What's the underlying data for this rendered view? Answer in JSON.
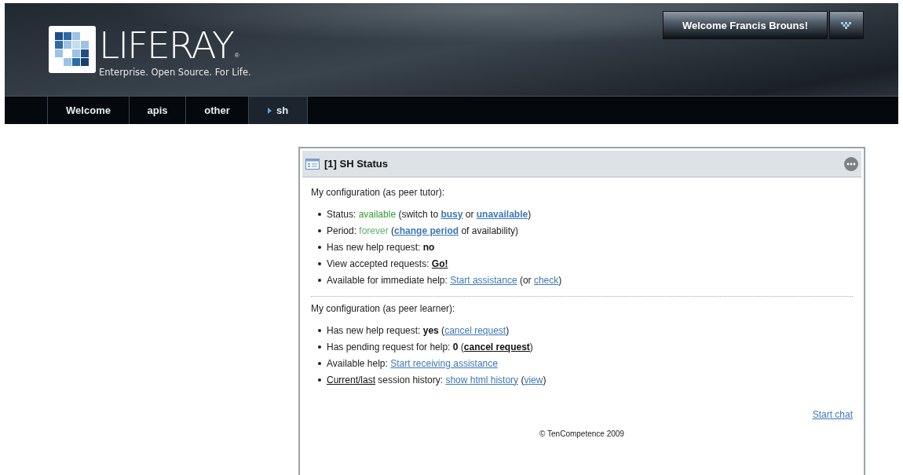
{
  "header": {
    "logo": {
      "wordmark": "LIFERAY",
      "registered": "®",
      "tagline": "Enterprise. Open Source. For Life."
    },
    "user_menu": {
      "label": "Welcome Francis Brouns!"
    },
    "nav": [
      {
        "label": "Welcome",
        "selected": false
      },
      {
        "label": "apis",
        "selected": false
      },
      {
        "label": "other",
        "selected": false
      },
      {
        "label": "sh",
        "selected": true
      }
    ]
  },
  "portlet": {
    "title": "[1] SH Status",
    "sections": [
      {
        "heading": "My configuration (as peer tutor):",
        "items": [
          {
            "parts": [
              {
                "kind": "text",
                "text": "Status: "
              },
              {
                "kind": "state",
                "text": "available"
              },
              {
                "kind": "text",
                "text": " (switch to "
              },
              {
                "kind": "strong-link",
                "text": "busy"
              },
              {
                "kind": "text",
                "text": " or "
              },
              {
                "kind": "strong-link",
                "text": "unavailable"
              },
              {
                "kind": "text",
                "text": ")"
              }
            ]
          },
          {
            "parts": [
              {
                "kind": "text",
                "text": "Period: "
              },
              {
                "kind": "duration",
                "text": "forever"
              },
              {
                "kind": "text",
                "text": " ("
              },
              {
                "kind": "strong-link",
                "text": "change period"
              },
              {
                "kind": "text",
                "text": " of availability)"
              }
            ]
          },
          {
            "parts": [
              {
                "kind": "text",
                "text": "Has new help request: "
              },
              {
                "kind": "bold",
                "text": "no"
              }
            ]
          },
          {
            "parts": [
              {
                "kind": "text",
                "text": "View accepted requests: "
              },
              {
                "kind": "dark-link",
                "text": "Go!"
              }
            ]
          },
          {
            "parts": [
              {
                "kind": "text",
                "text": "Available for immediate help: "
              },
              {
                "kind": "link",
                "text": "Start assistance"
              },
              {
                "kind": "text",
                "text": " (or "
              },
              {
                "kind": "link",
                "text": "check"
              },
              {
                "kind": "text",
                "text": ")"
              }
            ]
          }
        ]
      },
      {
        "heading": "My configuration (as peer learner):",
        "items": [
          {
            "parts": [
              {
                "kind": "text",
                "text": "Has new help request: "
              },
              {
                "kind": "bold",
                "text": "yes"
              },
              {
                "kind": "text",
                "text": " ("
              },
              {
                "kind": "link",
                "text": "cancel request"
              },
              {
                "kind": "text",
                "text": ")"
              }
            ]
          },
          {
            "parts": [
              {
                "kind": "text",
                "text": "Has pending request for help: "
              },
              {
                "kind": "bold",
                "text": "0"
              },
              {
                "kind": "text",
                "text": " ("
              },
              {
                "kind": "dark-link",
                "text": "cancel request"
              },
              {
                "kind": "text",
                "text": ")"
              }
            ]
          },
          {
            "parts": [
              {
                "kind": "text",
                "text": "Available help: "
              },
              {
                "kind": "link",
                "text": "Start receiving assistance"
              }
            ]
          },
          {
            "parts": [
              {
                "kind": "plain-link",
                "text": "Current/last"
              },
              {
                "kind": "text",
                "text": " session history: "
              },
              {
                "kind": "link",
                "text": "show html history"
              },
              {
                "kind": "text",
                "text": " ("
              },
              {
                "kind": "link",
                "text": "view"
              },
              {
                "kind": "text",
                "text": ")"
              }
            ]
          }
        ]
      }
    ],
    "start_chat": "Start chat",
    "footer": "© TenCompetence 2009"
  }
}
